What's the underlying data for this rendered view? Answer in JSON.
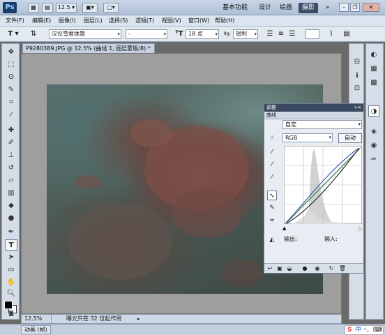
{
  "titlebar": {
    "app_logo": "Ps",
    "zoom_value": "12.5",
    "workspaces": [
      "基本功能",
      "设计",
      "绘画",
      "摄影"
    ],
    "active_workspace": "摄影"
  },
  "menubar": {
    "items": [
      "文件(F)",
      "编辑(E)",
      "图像(I)",
      "图层(L)",
      "选择(S)",
      "滤镜(T)",
      "视图(V)",
      "窗口(W)",
      "帮助(H)"
    ]
  },
  "options": {
    "tool_glyph": "T",
    "font_family": "汉仪雪君体简",
    "font_style": "-",
    "font_size": "18 点",
    "antialias": "锐利"
  },
  "document": {
    "tab_title": "P9280389.JPG @ 12.5% (曲线 1, 图层蒙版/8) *",
    "zoom": "12.5%",
    "status_text": "曝光只在 32 位起作用"
  },
  "bottom": {
    "anim_tab": "动画 (帧)",
    "ime_logo": "S",
    "ime_lang": "中"
  },
  "curves_panel": {
    "panel_title": "调整",
    "tab_label": "曲线",
    "preset": "自定",
    "channel": "RGB",
    "auto_button": "自动",
    "output_label": "输出:",
    "input_label": "输入:"
  },
  "colors": {
    "curve_blue": "#1a2fb0",
    "curve_green": "#2e8b2e",
    "curve_black": "#111111",
    "active_workspace_bg": "#3b4c66"
  }
}
